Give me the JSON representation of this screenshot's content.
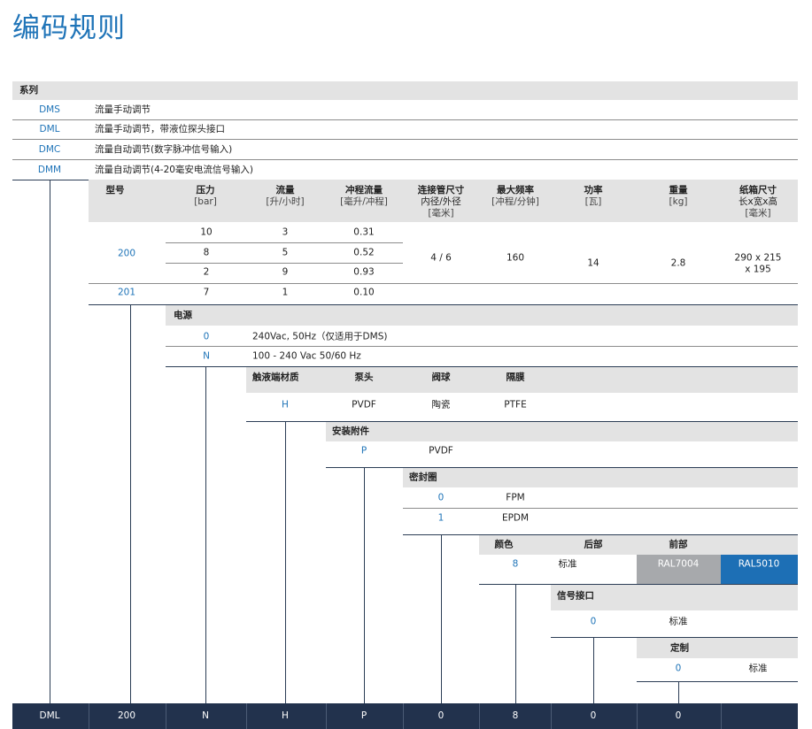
{
  "title": "编码规则",
  "series": {
    "header": "系列",
    "items": [
      {
        "code": "DMS",
        "desc": "流量手动调节"
      },
      {
        "code": "DML",
        "desc": "流量手动调节，带液位探头接口"
      },
      {
        "code": "DMC",
        "desc": "流量自动调节(数字脉冲信号输入)"
      },
      {
        "code": "DMM",
        "desc": "流量自动调节(4-20毫安电流信号输入)"
      }
    ]
  },
  "model_table": {
    "headers": [
      {
        "l1": "型号"
      },
      {
        "l1": "压力",
        "l2": "[bar]"
      },
      {
        "l1": "流量",
        "l2": "[升/小时]"
      },
      {
        "l1": "冲程流量",
        "l2": "[毫升/冲程]"
      },
      {
        "l1": "连接管尺寸",
        "l2": "内径/外径",
        "l3": "[毫米]"
      },
      {
        "l1": "最大频率",
        "l2": "[冲程/分钟]"
      },
      {
        "l1": "功率",
        "l2": "[瓦]"
      },
      {
        "l1": "重量",
        "l2": "[kg]"
      },
      {
        "l1": "纸箱尺寸",
        "l2": "长x宽x高",
        "l3": "[毫米]"
      }
    ],
    "model_200": "200",
    "model_201": "201",
    "rows": [
      {
        "pressure": "10",
        "flow": "3",
        "stroke": "0.31"
      },
      {
        "pressure": "8",
        "flow": "5",
        "stroke": "0.52"
      },
      {
        "pressure": "2",
        "flow": "9",
        "stroke": "0.93"
      },
      {
        "pressure": "7",
        "flow": "1",
        "stroke": "0.10"
      }
    ],
    "tube": "4 / 6",
    "frequency": "160",
    "power": "14",
    "weight": "2.8",
    "carton_l1": "290 x 215",
    "carton_l2": "x 195"
  },
  "power_supply": {
    "header": "电源",
    "items": [
      {
        "code": "0",
        "desc": "240Vac, 50Hz（仅适用于DMS)"
      },
      {
        "code": "N",
        "desc": "100 - 240 Vac 50/60 Hz"
      }
    ]
  },
  "wetted": {
    "header": "触液端材质",
    "col_pump": "泵头",
    "col_ball": "阀球",
    "col_diaphragm": "隔膜",
    "code": "H",
    "pump": "PVDF",
    "ball": "陶瓷",
    "diaphragm": "PTFE"
  },
  "mounting": {
    "header": "安装附件",
    "code": "P",
    "desc": "PVDF"
  },
  "seal": {
    "header": "密封圈",
    "items": [
      {
        "code": "0",
        "desc": "FPM"
      },
      {
        "code": "1",
        "desc": "EPDM"
      }
    ]
  },
  "color": {
    "header": "颜色",
    "col_rear": "后部",
    "col_front": "前部",
    "code": "8",
    "desc": "标准",
    "rear": "RAL7004",
    "front": "RAL5010",
    "rear_color": "#a7a9ac",
    "front_color": "#1d6fb5"
  },
  "signal": {
    "header": "信号接口",
    "code": "0",
    "desc": "标准"
  },
  "custom": {
    "header": "定制",
    "code": "0",
    "desc": "标准"
  },
  "bottom_bar": [
    "DML",
    "200",
    "N",
    "H",
    "P",
    "0",
    "8",
    "0",
    "0",
    ""
  ],
  "colors": {
    "accent": "#1f74b8",
    "header_bg": "#e3e3e3",
    "bar_bg": "#22324d"
  }
}
